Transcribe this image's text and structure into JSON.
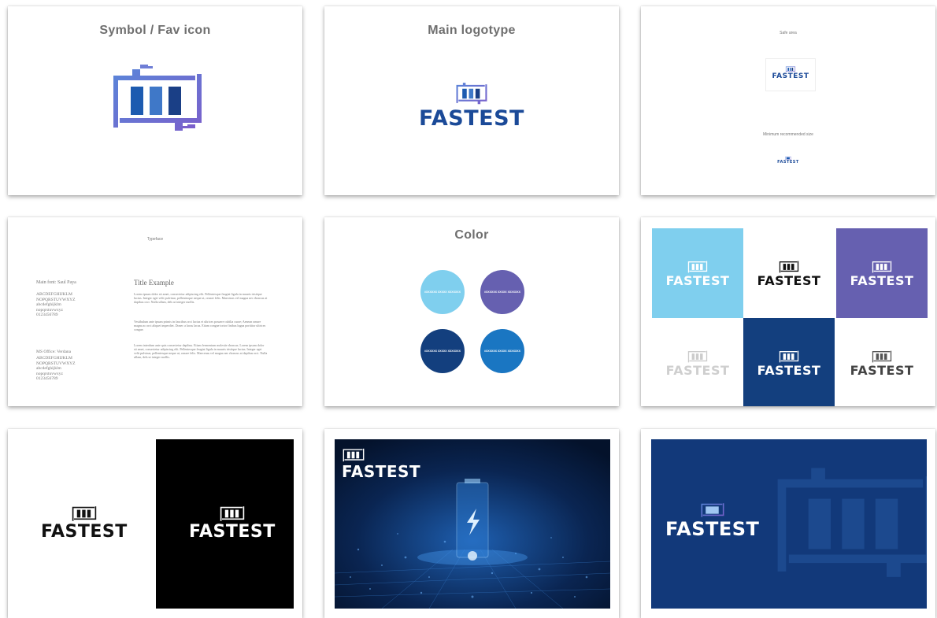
{
  "slides": {
    "symbol": {
      "title": "Symbol / Fav icon"
    },
    "logotype": {
      "title": "Main logotype",
      "wordmark": "FASTEST"
    },
    "safe_area": {
      "safe_label": "Safe area",
      "min_label": "Minimum recommended size",
      "wordmark": "FASTEST"
    },
    "typography": {
      "header": "Typeface",
      "main_font_name": "Main font: Saul Paya",
      "main_glyphs": [
        "ABCDEFGHIJKLM",
        "NOPQRSTUVWXYZ",
        "abcdefghijklm",
        "nopqrstuvwxyz",
        "0123456789"
      ],
      "alt_font_name": "MS Office: Verdana",
      "alt_glyphs": [
        "ABCDEFGHIJKLM",
        "NOPQRSTUVWXYZ",
        "abcdefghijklm",
        "nopqrstuvwxyz",
        "0123456789"
      ],
      "example_title": "Title Example",
      "para1": "Lorem ipsum dolor sit amet, consectetur adipiscing elit. Pellentesque feugiat ligula in mauris tristique luctus. Integer eget velit pulvinar, pellentesque neque ut, ornare felis. Maecenas vel magna nec rhoncus at dapibus orci. Nulla ullam, dels ut integer mollis.",
      "para2": "Vestibulum ante ipsum primis in faucibus orci luctus et ultrices posuere cubilia curae; Aenean ornare magna ac orci aliquet imperdiet. Donec a lacus lacus. Etiam congue tortor finibus lugna porttitor ultrices congue.",
      "para3": "Lorem interdum ante quis consectetur dapibus. Etiam fermentum molestie rhoncus. Lorem ipsum dolor sit amet, consectetur adipiscing elit. Pellentesque feugiat ligula in mauris tristique luctus. Integer eget velit pulvinar, pellentesque neque ut, ornare felis. Maecenas vel magna nec rhoncus at dapibus orci. Nulla ullam, dels ut integer mollis."
    },
    "color": {
      "title": "Color",
      "swatches": [
        {
          "hex": "#7fcfee",
          "label": "#XXXXXX XXXXX XXXXXXX"
        },
        {
          "hex": "#6660b0",
          "label": "#XXXXXX XXXXX XXXXXXX"
        },
        {
          "hex": "#133f7e",
          "label": "#XXXXXX XXXXX XXXXXXX"
        },
        {
          "hex": "#1a76c2",
          "label": "#XXXXXX XXXXX XXXXXXX"
        }
      ]
    },
    "variants": {
      "wordmark": "FASTEST"
    },
    "mono": {
      "wordmark": "FASTEST"
    },
    "photo": {
      "wordmark": "FASTEST"
    },
    "pattern": {
      "wordmark": "FASTEST"
    }
  },
  "colors": {
    "brand_dark": "#1b3f86",
    "brand_blue": "#1f5fb0",
    "gradient_a": "#5a86d9",
    "gradient_b": "#7a5fcb",
    "light_blue": "#7fcfee",
    "purple": "#6660b0",
    "navy": "#133f7e"
  },
  "icons": [
    "battery-plug-icon",
    "lightning-icon"
  ]
}
